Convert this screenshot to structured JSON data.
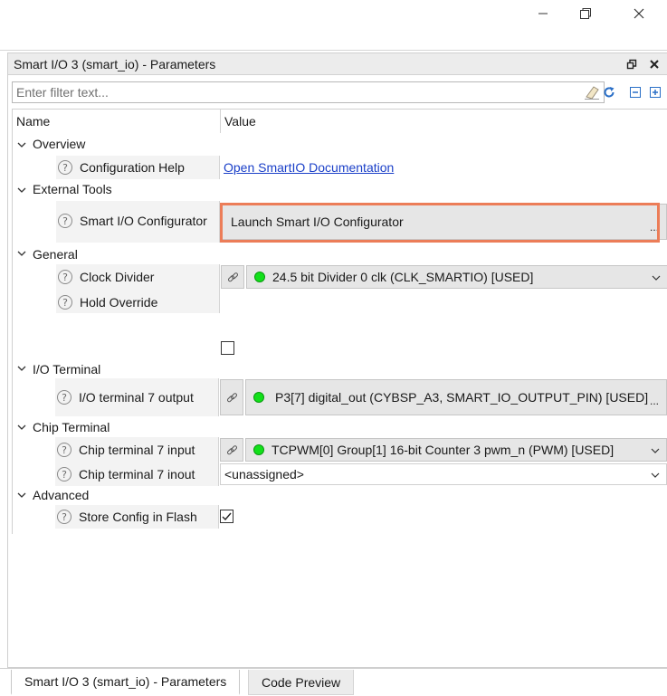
{
  "window": {
    "controls": [
      "minimize-icon",
      "restore-icon",
      "close-icon"
    ]
  },
  "panel": {
    "title": "Smart I/O 3 (smart_io) - Parameters",
    "icons": [
      "maximize-icon",
      "close-icon"
    ]
  },
  "filter": {
    "placeholder": "Enter filter text...",
    "value": "",
    "icons": [
      "eraser-icon",
      "refresh-icon",
      "collapse-all-icon",
      "expand-all-icon"
    ]
  },
  "grid": {
    "columns": [
      "Name",
      "Value"
    ],
    "categories": {
      "overview": "Overview",
      "external_tools": "External Tools",
      "general": "General",
      "io_terminal": "I/O Terminal",
      "chip_terminal": "Chip Terminal",
      "advanced": "Advanced"
    },
    "params": {
      "config_help": {
        "name": "Configuration Help",
        "value": "Open SmartIO Documentation"
      },
      "smart_io_configurator": {
        "name": "Smart I/O Configurator",
        "value": "Launch Smart I/O Configurator",
        "ellipsis": "..."
      },
      "clock_divider": {
        "name": "Clock Divider",
        "value": "24.5 bit Divider 0 clk (CLK_SMARTIO) [USED]",
        "status_color": "#12e01a"
      },
      "hold_override": {
        "name": "Hold Override",
        "checked": false
      },
      "io_terminal_7_output": {
        "name": "I/O terminal 7 output",
        "value": "P3[7] digital_out (CYBSP_A3, SMART_IO_OUTPUT_PIN) [USED]",
        "ellipsis": "...",
        "status_color": "#12e01a"
      },
      "chip_terminal_7_input": {
        "name": "Chip terminal 7 input",
        "value": "TCPWM[0] Group[1] 16-bit Counter 3 pwm_n (PWM) [USED]",
        "status_color": "#12e01a"
      },
      "chip_terminal_7_inout": {
        "name": "Chip terminal 7 inout",
        "value": "<unassigned>"
      },
      "store_config_in_flash": {
        "name": "Store Config in Flash",
        "checked": true
      }
    }
  },
  "tabs": [
    {
      "label": "Smart I/O 3 (smart_io) - Parameters",
      "active": true
    },
    {
      "label": "Code Preview",
      "active": false
    }
  ],
  "colors": {
    "highlight": "#ec7d58",
    "link": "#1a3fc8",
    "status_ok": "#12e01a"
  }
}
